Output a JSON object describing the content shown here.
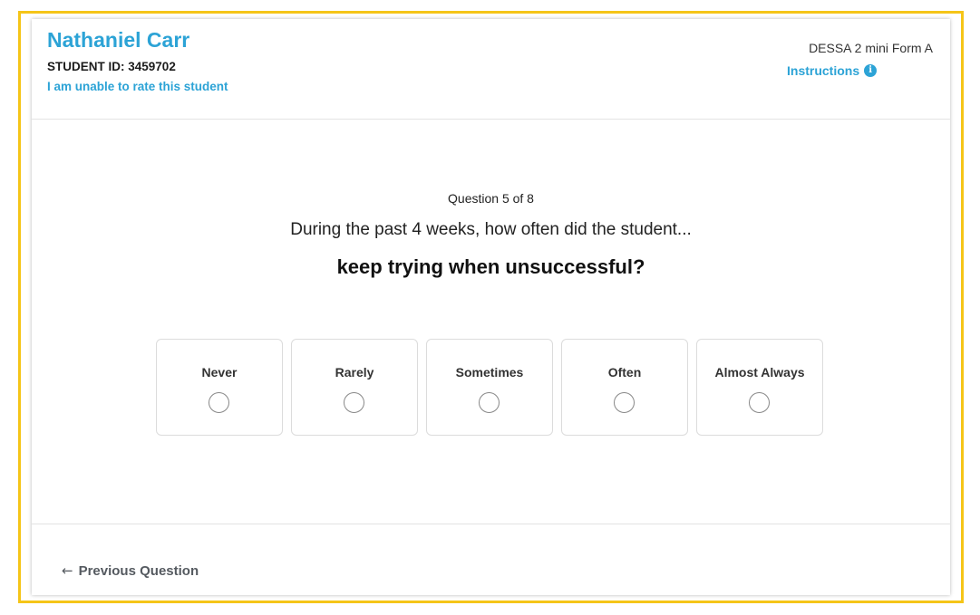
{
  "header": {
    "student_name": "Nathaniel Carr",
    "student_id_label": "STUDENT ID:",
    "student_id": "3459702",
    "unable_link": "I am unable to rate this student",
    "form_name": "DESSA 2 mini Form A",
    "instructions_link": "Instructions",
    "info_icon": "info-circle-icon"
  },
  "question": {
    "counter": "Question 5 of 8",
    "prompt": "During the past 4 weeks, how often did the student...",
    "text": "keep trying when unsuccessful?"
  },
  "options": [
    {
      "label": "Never",
      "selected": false
    },
    {
      "label": "Rarely",
      "selected": false
    },
    {
      "label": "Sometimes",
      "selected": false
    },
    {
      "label": "Often",
      "selected": false
    },
    {
      "label": "Almost Always",
      "selected": false
    }
  ],
  "footer": {
    "prev_button": "Previous Question",
    "prev_icon": "arrow-left-icon"
  },
  "colors": {
    "accent": "#2ca3d6",
    "frame_highlight": "#f5c518"
  }
}
